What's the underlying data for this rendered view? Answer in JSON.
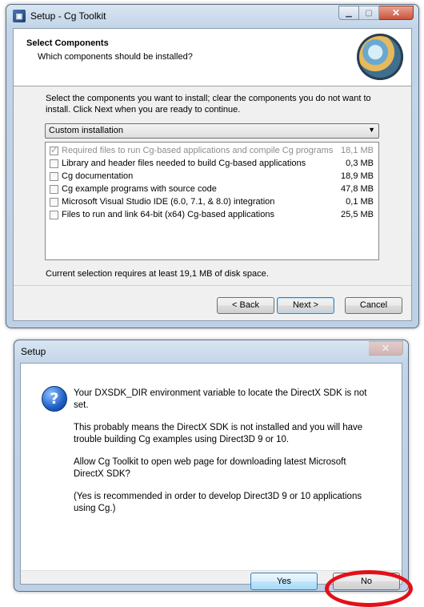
{
  "setup_window": {
    "title": "Setup - Cg Toolkit",
    "header": {
      "title": "Select Components",
      "subtitle": "Which components should be installed?"
    },
    "intro_text": "Select the components you want to install; clear the components you do not want to install. Click Next when you are ready to continue.",
    "install_type": "Custom installation",
    "components": [
      {
        "label": "Required files to run Cg-based applications and compile Cg programs",
        "size": "18,1 MB",
        "checked": true,
        "disabled": true
      },
      {
        "label": "Library and header files needed to build Cg-based applications",
        "size": "0,3 MB",
        "checked": false,
        "disabled": false
      },
      {
        "label": "Cg documentation",
        "size": "18,9 MB",
        "checked": false,
        "disabled": false
      },
      {
        "label": "Cg example programs with source code",
        "size": "47,8 MB",
        "checked": false,
        "disabled": false
      },
      {
        "label": "Microsoft Visual Studio IDE (6.0, 7.1, & 8.0) integration",
        "size": "0,1 MB",
        "checked": false,
        "disabled": false
      },
      {
        "label": "Files to run and link 64-bit (x64) Cg-based applications",
        "size": "25,5 MB",
        "checked": false,
        "disabled": false
      }
    ],
    "status_text": "Current selection requires at least 19,1 MB of disk space.",
    "buttons": {
      "back": "< Back",
      "next": "Next >",
      "cancel": "Cancel"
    }
  },
  "message_box": {
    "title": "Setup",
    "paragraphs": [
      "Your DXSDK_DIR environment variable to locate the DirectX SDK is not set.",
      "This probably means the DirectX SDK is not installed and you will have trouble building Cg examples using Direct3D 9 or 10.",
      "Allow Cg Toolkit to open web page for downloading latest Microsoft DirectX SDK?",
      "(Yes is recommended in order to develop Direct3D 9 or 10 applications using Cg.)"
    ],
    "buttons": {
      "yes": "Yes",
      "no": "No"
    }
  },
  "icons": {
    "app": "setup-app-icon",
    "question": "question-icon",
    "logo": "cg-toolkit-logo"
  },
  "colors": {
    "highlight_circle": "#e3101a",
    "title_gradient": "#c3d5e8"
  }
}
